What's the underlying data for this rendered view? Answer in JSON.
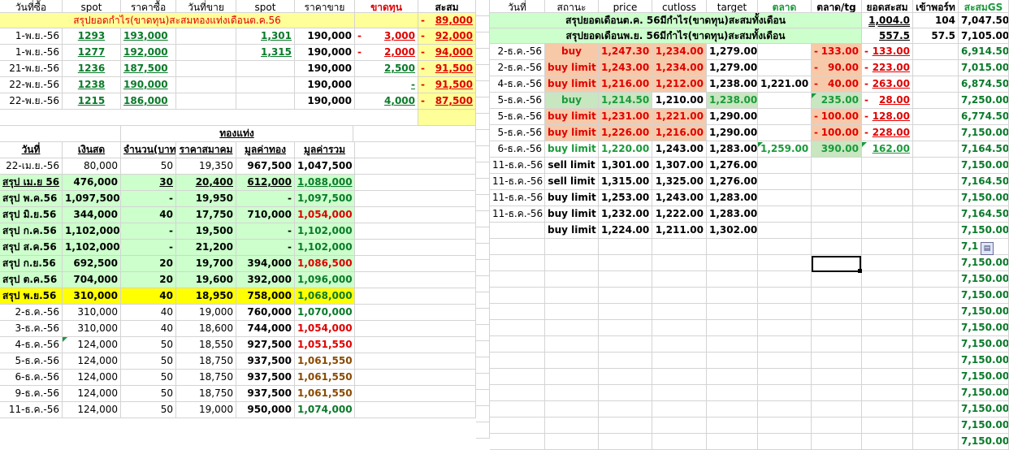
{
  "left_header": [
    "วันที่ซื้อ",
    "spot",
    "ราคาซื้อ",
    "วันที่ขาย",
    "spot",
    "ราคาขาย",
    "ขาดทุน",
    "สะสม"
  ],
  "left_summary": {
    "label": "สรุปยอดกำไร(ขาดทุน)สะสมทองแท่งเดือนต.ค.56",
    "value": "89,000"
  },
  "left_trades": [
    {
      "buy_date": "1-พ.ย.-56",
      "spot1": "1293",
      "buy_price": "193,000",
      "sell_date": "",
      "spot2": "1,301",
      "sell_price": "190,000",
      "loss": "3,000",
      "cum": "92,000"
    },
    {
      "buy_date": "1-พ.ย.-56",
      "spot1": "1277",
      "buy_price": "192,000",
      "sell_date": "",
      "spot2": "1,315",
      "sell_price": "190,000",
      "loss": "2,000",
      "cum": "94,000"
    },
    {
      "buy_date": "21-พ.ย.-56",
      "spot1": "1236",
      "buy_price": "187,500",
      "sell_date": "",
      "spot2": "",
      "sell_price": "190,000",
      "loss": "2,500",
      "cum": "91,500"
    },
    {
      "buy_date": "22-พ.ย.-56",
      "spot1": "1238",
      "buy_price": "190,000",
      "sell_date": "",
      "spot2": "",
      "sell_price": "190,000",
      "loss": "-",
      "cum": "91,500"
    },
    {
      "buy_date": "22-พ.ย.-56",
      "spot1": "1215",
      "buy_price": "186,000",
      "sell_date": "",
      "spot2": "",
      "sell_price": "190,000",
      "loss": "4,000",
      "cum": "87,500"
    }
  ],
  "gold_bar_title": "ทองแท่ง",
  "bottom_header": [
    "วันที่",
    "เงินสด",
    "จำนวน(บาท)",
    "ราคาสมาคม",
    "มูลค่าทอง",
    "มูลค่ารวม"
  ],
  "bottom_rows": [
    {
      "date": "22-เม.ย.-56",
      "cash": "80,000",
      "qty": "50",
      "price": "19,350",
      "gold": "967,500",
      "total": "1,047,500",
      "style": "plain",
      "tc": "black"
    },
    {
      "date": "สรุป เม.ย 56",
      "cash": "476,000",
      "qty": "30",
      "price": "20,400",
      "gold": "612,000",
      "total": "1,088,000",
      "style": "green",
      "tc": "dgrn"
    },
    {
      "date": "สรุป พ.ค.56",
      "cash": "1,097,500",
      "qty": "-",
      "price": "19,950",
      "gold": "-",
      "total": "1,097,500",
      "style": "green",
      "tc": "dgrn"
    },
    {
      "date": "สรุป มิ.ย.56",
      "cash": "344,000",
      "qty": "40",
      "price": "17,750",
      "gold": "710,000",
      "total": "1,054,000",
      "style": "green",
      "tc": "red"
    },
    {
      "date": "สรุป ก.ค.56",
      "cash": "1,102,000",
      "qty": "-",
      "price": "19,500",
      "gold": "-",
      "total": "1,102,000",
      "style": "green",
      "tc": "dgrn"
    },
    {
      "date": "สรุป ส.ค.56",
      "cash": "1,102,000",
      "qty": "-",
      "price": "21,200",
      "gold": "-",
      "total": "1,102,000",
      "style": "green",
      "tc": "dgrn"
    },
    {
      "date": "สรุป ก.ย.56",
      "cash": "692,500",
      "qty": "20",
      "price": "19,700",
      "gold": "394,000",
      "total": "1,086,500",
      "style": "green",
      "tc": "red"
    },
    {
      "date": "สรุป ต.ค.56",
      "cash": "704,000",
      "qty": "20",
      "price": "19,600",
      "gold": "392,000",
      "total": "1,096,000",
      "style": "green",
      "tc": "dgrn"
    },
    {
      "date": "สรุป พ.ย.56",
      "cash": "310,000",
      "qty": "40",
      "price": "18,950",
      "gold": "758,000",
      "total": "1,068,000",
      "style": "yellow",
      "tc": "dgrn"
    },
    {
      "date": "2-ธ.ค.-56",
      "cash": "310,000",
      "qty": "40",
      "price": "19,000",
      "gold": "760,000",
      "total": "1,070,000",
      "style": "plain",
      "tc": "dgrn"
    },
    {
      "date": "3-ธ.ค.-56",
      "cash": "310,000",
      "qty": "40",
      "price": "18,600",
      "gold": "744,000",
      "total": "1,054,000",
      "style": "plain",
      "tc": "red"
    },
    {
      "date": "4-ธ.ค.-56",
      "cash": "124,000",
      "qty": "50",
      "price": "18,550",
      "gold": "927,500",
      "total": "1,051,550",
      "style": "plain",
      "tc": "red"
    },
    {
      "date": "5-ธ.ค.-56",
      "cash": "124,000",
      "qty": "50",
      "price": "18,750",
      "gold": "937,500",
      "total": "1,061,550",
      "style": "plain",
      "tc": "brn"
    },
    {
      "date": "6-ธ.ค.-56",
      "cash": "124,000",
      "qty": "50",
      "price": "18,750",
      "gold": "937,500",
      "total": "1,061,550",
      "style": "plain",
      "tc": "brn"
    },
    {
      "date": "9-ธ.ค.-56",
      "cash": "124,000",
      "qty": "50",
      "price": "18,750",
      "gold": "937,500",
      "total": "1,061,550",
      "style": "plain",
      "tc": "brn"
    },
    {
      "date": "11-ธ.ค.-56",
      "cash": "124,000",
      "qty": "50",
      "price": "19,000",
      "gold": "950,000",
      "total": "1,074,000",
      "style": "plain",
      "tc": "dgrn"
    }
  ],
  "right_header": [
    "วันที่",
    "สถานะ",
    "price",
    "cutloss",
    "target",
    "ตลาด",
    "ตลาด/tg",
    "ยอดสะสม",
    "เข้าพอร์ท",
    "สะสมGS"
  ],
  "right_summaries": [
    {
      "label": "สรุปยอดเดือนต.ค. 56มีกำไร(ขาดทุน)สะสมทั้งเดือน",
      "total": "1,004.0",
      "port": "104",
      "gs": "7,047.50"
    },
    {
      "label": "สรุปยอดเดือนพ.ย. 56มีกำไร(ขาดทุน)สะสมทั้งเดือน",
      "total": "557.5",
      "port": "57.5",
      "gs": "7,105.00"
    }
  ],
  "right_rows": [
    {
      "date": "2-ธ.ค.-56",
      "status": "buy",
      "price": "1,247.30",
      "cut": "1,234.00",
      "target": "1,279.00",
      "mkt": "",
      "mtg": "133.00",
      "cum": "133.00",
      "gs": "6,914.50",
      "kind": "salmon",
      "mtgc": "red",
      "cumc": "red",
      "mtgneg": true,
      "cumneg": true
    },
    {
      "date": "2-ธ.ค.-56",
      "status": "buy limit",
      "price": "1,243.00",
      "cut": "1,234.00",
      "target": "1,279.00",
      "mkt": "",
      "mtg": "90.00",
      "cum": "223.00",
      "gs": "7,015.00",
      "kind": "salmon",
      "mtgc": "red",
      "cumc": "red",
      "mtgneg": true,
      "cumneg": true
    },
    {
      "date": "4-ธ.ค.-56",
      "status": "buy limit",
      "price": "1,216.00",
      "cut": "1,212.00",
      "target": "1,238.00",
      "mkt": "1,221.00",
      "mtg": "40.00",
      "cum": "263.00",
      "gs": "6,874.50",
      "kind": "salmon",
      "mtgc": "red",
      "cumc": "red",
      "mtgneg": true,
      "cumneg": true
    },
    {
      "date": "5-ธ.ค.-56",
      "status": "buy",
      "price": "1,214.50",
      "cut": "1,210.00",
      "target": "1,238.00",
      "mkt": "",
      "mtg": "235.00",
      "cum": "28.00",
      "gs": "7,250.00",
      "kind": "green",
      "mtgc": "grn",
      "cumc": "red",
      "mtgneg": false,
      "cumneg": true
    },
    {
      "date": "5-ธ.ค.-56",
      "status": "buy limit",
      "price": "1,231.00",
      "cut": "1,221.00",
      "target": "1,290.00",
      "mkt": "",
      "mtg": "100.00",
      "cum": "128.00",
      "gs": "6,774.50",
      "kind": "salmon",
      "mtgc": "red",
      "cumc": "red",
      "mtgneg": true,
      "cumneg": true
    },
    {
      "date": "5-ธ.ค.-56",
      "status": "buy limit",
      "price": "1,226.00",
      "cut": "1,216.00",
      "target": "1,290.00",
      "mkt": "",
      "mtg": "100.00",
      "cum": "228.00",
      "gs": "7,150.00",
      "kind": "salmon",
      "mtgc": "red",
      "cumc": "red",
      "mtgneg": true,
      "cumneg": true
    },
    {
      "date": "6-ธ.ค.-56",
      "status": "buy limit",
      "price": "1,220.00",
      "cut": "1,243.00",
      "target": "1,283.00",
      "mkt": "1,259.00",
      "mtg": "390.00",
      "cum": "162.00",
      "gs": "7,164.50",
      "kind": "lightgreen",
      "mtgc": "grn",
      "cumc": "grn",
      "mtgneg": false,
      "cumneg": false
    },
    {
      "date": "11-ธ.ค.-56",
      "status": "sell limit",
      "price": "1,301.00",
      "cut": "1,307.00",
      "target": "1,276.00",
      "mkt": "",
      "mtg": "",
      "cum": "",
      "gs": "7,150.00",
      "kind": "plain"
    },
    {
      "date": "11-ธ.ค.-56",
      "status": "sell limit",
      "price": "1,315.00",
      "cut": "1,325.00",
      "target": "1,276.00",
      "mkt": "",
      "mtg": "",
      "cum": "",
      "gs": "7,164.50",
      "kind": "plain"
    },
    {
      "date": "11-ธ.ค.-56",
      "status": "buy limit",
      "price": "1,253.00",
      "cut": "1,243.00",
      "target": "1,283.00",
      "mkt": "",
      "mtg": "",
      "cum": "",
      "gs": "7,150.00",
      "kind": "plain"
    },
    {
      "date": "11-ธ.ค.-56",
      "status": "buy limit",
      "price": "1,232.00",
      "cut": "1,222.00",
      "target": "1,283.00",
      "mkt": "",
      "mtg": "",
      "cum": "",
      "gs": "7,164.50",
      "kind": "plain"
    },
    {
      "date": "",
      "status": "buy limit",
      "price": "1,224.00",
      "cut": "1,211.00",
      "target": "1,302.00",
      "mkt": "",
      "mtg": "",
      "cum": "",
      "gs": "7,150.00",
      "kind": "plain"
    }
  ],
  "gs_tail": [
    "7,150.00",
    "7,150.00",
    "7,150.00",
    "7,150.00",
    "7,150.00",
    "7,150.00",
    "7,150.00",
    "7,150.00",
    "7,150.00",
    "7,150.00",
    "7,150.00",
    "7,150.00"
  ],
  "gs_partial": "7,1",
  "colors": {
    "yellow_fill": "#ffff99",
    "green_fill": "#ccffcc",
    "salmon_fill": "#f7c9a8",
    "highlight": "#ffff00",
    "red": "#e00000",
    "green": "#1a9a3a"
  }
}
